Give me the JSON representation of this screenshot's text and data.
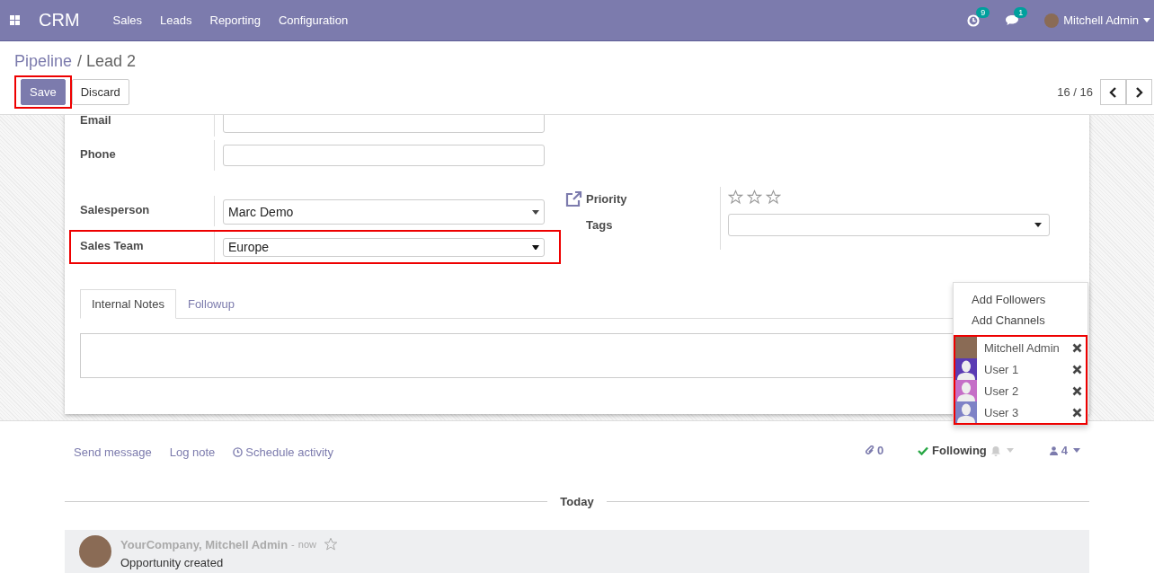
{
  "navbar": {
    "app": "CRM",
    "menu": [
      "Sales",
      "Leads",
      "Reporting",
      "Configuration"
    ],
    "activity_count": "9",
    "message_count": "1",
    "user": "Mitchell Admin"
  },
  "breadcrumb": [
    {
      "label": "Pipeline",
      "kind": "link"
    },
    {
      "label": "/ Lead 2",
      "kind": "current"
    }
  ],
  "buttons": [
    {
      "label": "Save",
      "kind": "primary",
      "highlighted": true
    },
    {
      "label": "Discard",
      "kind": "secondary",
      "highlighted": false
    }
  ],
  "pager": "16 / 16",
  "form": {
    "left": [
      {
        "label": "Email",
        "kind": "input",
        "highlighted": false
      },
      {
        "label": "Phone",
        "kind": "input",
        "highlighted": false
      },
      {
        "label": "Salesperson",
        "kind": "select",
        "value": "Marc Demo",
        "highlighted": false
      },
      {
        "label": "Sales Team",
        "kind": "native-select",
        "value": "Europe",
        "highlighted": true
      }
    ],
    "priority": {
      "label": "Priority",
      "stars": 0
    },
    "tags": {
      "label": "Tags"
    }
  },
  "tabs": [
    {
      "label": "Internal Notes",
      "selected": true
    },
    {
      "label": "Followup",
      "selected": false
    }
  ],
  "followers_menu": {
    "actions": [
      "Add Followers",
      "Add Channels"
    ],
    "highlighted": true,
    "followers": [
      {
        "name": "Mitchell Admin",
        "kind": "photo"
      },
      {
        "name": "User 1",
        "kind": "silhouette",
        "color": "#5a3bb3"
      },
      {
        "name": "User 2",
        "kind": "silhouette",
        "color": "#c56ec7"
      },
      {
        "name": "User 3",
        "kind": "silhouette",
        "color": "#7e82c6"
      }
    ]
  },
  "chatter": {
    "actions": [
      {
        "label": "Send message",
        "kind": "link"
      },
      {
        "label": "Log note",
        "kind": "link"
      },
      {
        "label": "Schedule activity",
        "kind": "clock"
      }
    ],
    "attachments": "0",
    "follow_label": "Following",
    "following": true,
    "follower_count": "4",
    "divider": "Today",
    "messages": [
      {
        "author": "YourCompany, Mitchell Admin",
        "separator": "-",
        "time": "now",
        "body": "Opportunity created",
        "starred": false
      }
    ]
  }
}
